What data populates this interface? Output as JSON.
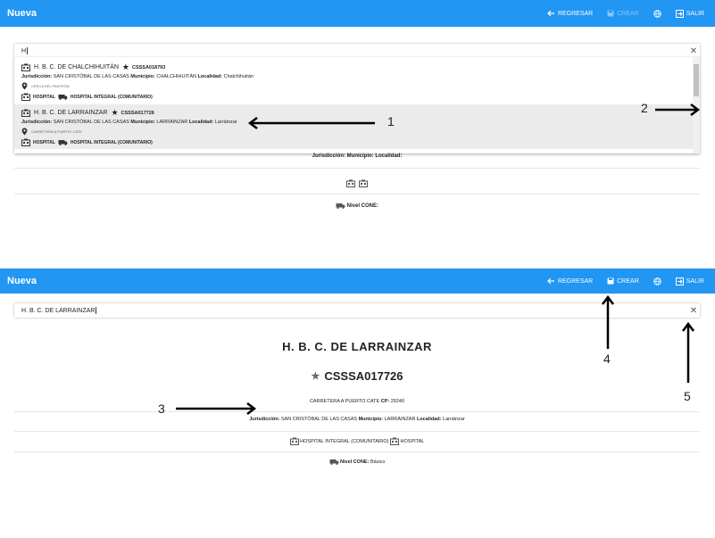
{
  "appbar": {
    "title": "Nueva",
    "back_label": "REGRESAR",
    "create_label": "CREAR",
    "exit_label": "SALIR"
  },
  "top": {
    "search_value": "H",
    "options": [
      {
        "name": "H. B. C. DE CHALCHIHUITÁN",
        "code": "CSSSA018793",
        "juris_label": "Jurisdicción:",
        "juris_value": "SAN CRISTÓBAL DE LAS CASAS",
        "mun_label": "Municipio:",
        "mun_value": "CHALCHIHUITÁN",
        "loc_label": "Localidad:",
        "loc_value": "Chalchihuitán",
        "address": "CERCA DEL PANTEÓN",
        "tag1": "HOSPITAL",
        "tag2": "HOSPITAL INTEGRAL (COMUNITARIO)"
      },
      {
        "name": "H. B. C. DE LARRAINZAR",
        "code": "CSSSA017726",
        "juris_label": "Jurisdicción:",
        "juris_value": "SAN CRISTÓBAL DE LAS CASAS",
        "mun_label": "Municipio:",
        "mun_value": "LARRÁINZAR",
        "loc_label": "Localidad:",
        "loc_value": "Larráinzar",
        "address": "CARRETERA A PUERTO CATE",
        "tag1": "HOSPITAL",
        "tag2": "HOSPITAL INTEGRAL (COMUNITARIO)"
      }
    ],
    "detail_juris_line": "Jurisdicción: Municipio: Localidad:",
    "detail_cone_label": "Nivel CONE:"
  },
  "bottom": {
    "search_value": "H. B. C. DE LARRAINZAR",
    "unit_name": "H. B. C. DE LARRAINZAR",
    "unit_code": "CSSSA017726",
    "address": "CARRETERA A PUERTO CATE",
    "cp_label": "CP:",
    "cp_value": "29240",
    "juris_label": "Jurisdicción:",
    "juris_value": "SAN CRISTÓBAL DE LAS CASAS",
    "mun_label": "Municipio:",
    "mun_value": "LARRÁINZAR",
    "loc_label": "Localidad:",
    "loc_value": "Larráinzar",
    "type1": "HOSPITAL INTEGRAL (COMUNITARIO)",
    "type2": "HOSPITAL",
    "cone_label": "Nivel CONE:",
    "cone_value": "Básico"
  },
  "annotations": [
    "1",
    "2",
    "3",
    "4",
    "5"
  ],
  "colors": {
    "appbar": "#2196f3",
    "highlight": "#ebebeb"
  }
}
